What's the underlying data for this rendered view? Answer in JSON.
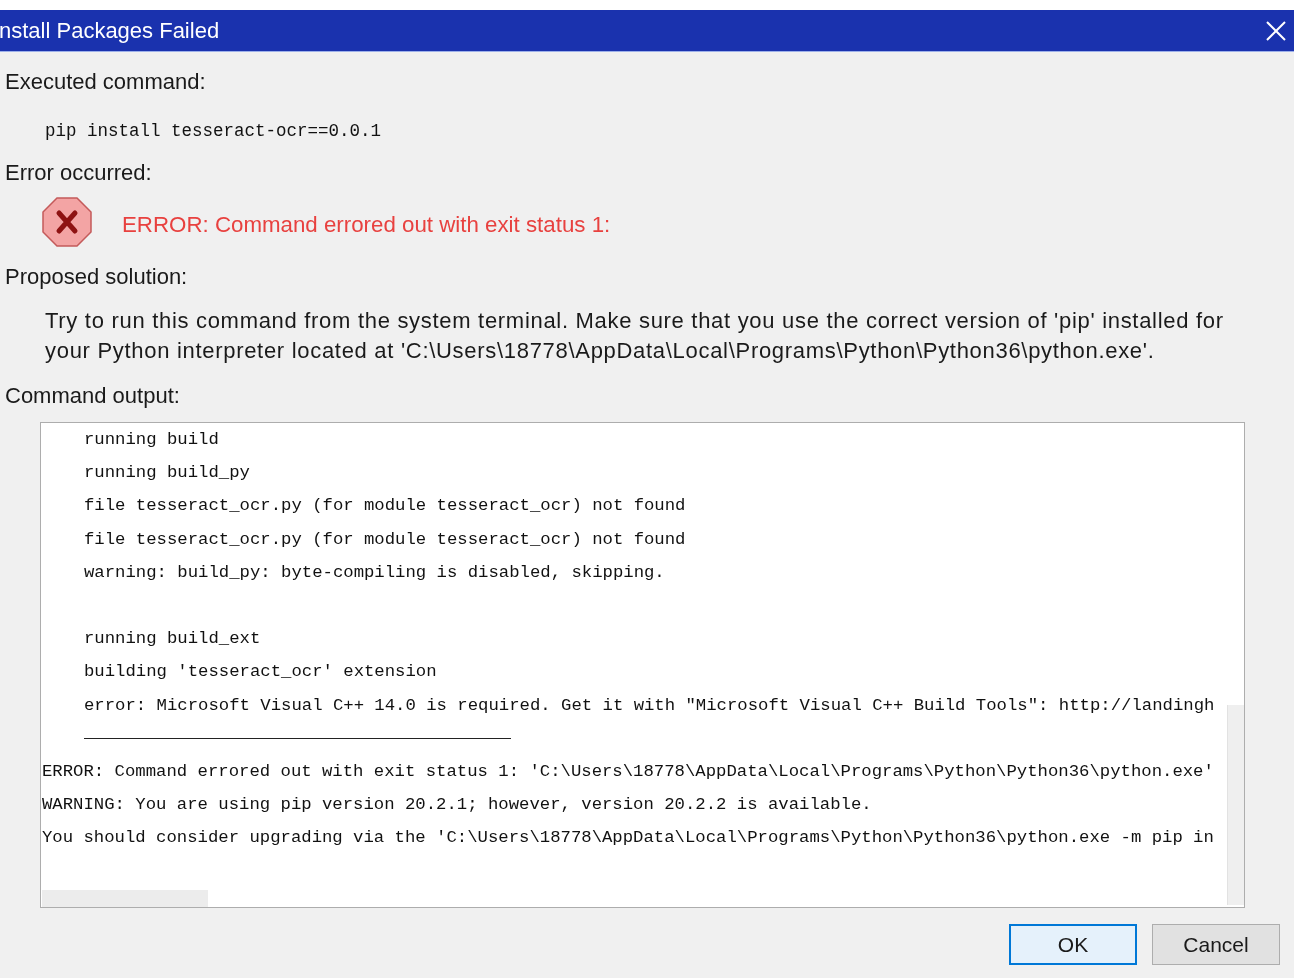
{
  "window": {
    "title": "nstall Packages Failed"
  },
  "executed_command": {
    "label": "Executed command:",
    "command": "pip install tesseract-ocr==0.0.1"
  },
  "error": {
    "label": "Error occurred:",
    "message": "ERROR: Command errored out with exit status 1:"
  },
  "proposed_solution": {
    "label": "Proposed solution:",
    "text": "Try to run this command from the system terminal. Make sure that you use the correct version of 'pip' installed for your Python interpreter located at 'C:\\Users\\18778\\AppData\\Local\\Programs\\Python\\Python36\\python.exe'."
  },
  "command_output": {
    "label": "Command output:",
    "lines": [
      {
        "kind": "text",
        "text": "running build",
        "indented": true
      },
      {
        "kind": "text",
        "text": "running build_py",
        "indented": true
      },
      {
        "kind": "text",
        "text": "file tesseract_ocr.py (for module tesseract_ocr) not found",
        "indented": true
      },
      {
        "kind": "text",
        "text": "file tesseract_ocr.py (for module tesseract_ocr) not found",
        "indented": true
      },
      {
        "kind": "text",
        "text": "warning: build_py: byte-compiling is disabled, skipping.",
        "indented": true
      },
      {
        "kind": "blank"
      },
      {
        "kind": "text",
        "text": "running build_ext",
        "indented": true
      },
      {
        "kind": "text",
        "text": "building 'tesseract_ocr' extension",
        "indented": true
      },
      {
        "kind": "text",
        "text": "error: Microsoft Visual C++ 14.0 is required. Get it with \"Microsoft Visual C++ Build Tools\": http://landingh",
        "indented": true
      },
      {
        "kind": "rule"
      },
      {
        "kind": "text",
        "text": "ERROR: Command errored out with exit status 1: 'C:\\Users\\18778\\AppData\\Local\\Programs\\Python\\Python36\\python.exe'",
        "indented": false
      },
      {
        "kind": "text",
        "text": "WARNING: You are using pip version 20.2.1; however, version 20.2.2 is available.",
        "indented": false
      },
      {
        "kind": "text",
        "text": "You should consider upgrading via the 'C:\\Users\\18778\\AppData\\Local\\Programs\\Python\\Python36\\python.exe -m pip in",
        "indented": false
      }
    ]
  },
  "buttons": [
    {
      "label": "OK",
      "focused": true
    },
    {
      "label": "Cancel",
      "focused": false
    }
  ]
}
